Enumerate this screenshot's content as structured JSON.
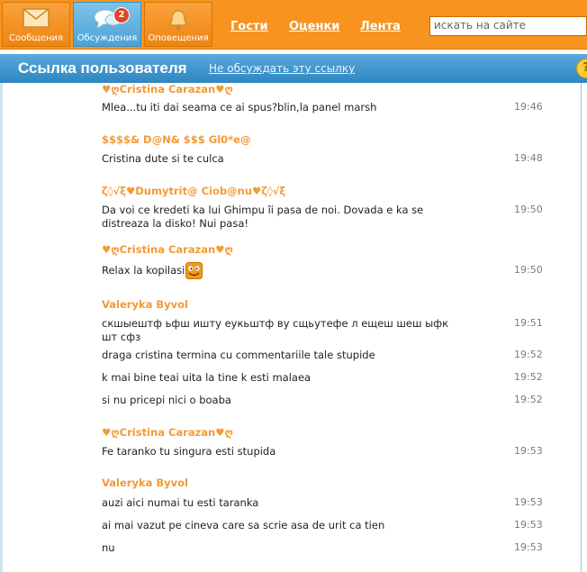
{
  "nav": {
    "tiles": [
      {
        "label": "Сообщения",
        "icon": "envelope-icon"
      },
      {
        "label": "Обсуждения",
        "icon": "chat-bubbles-icon",
        "badge": "2"
      },
      {
        "label": "Оповещения",
        "icon": "bell-icon"
      }
    ],
    "links": [
      "Гости",
      "Оценки",
      "Лента"
    ],
    "search_placeholder": "искать на сайте"
  },
  "header": {
    "title": "Ссылка пользователя",
    "action_link": "Не обсуждать эту ссылку",
    "help_icon": "help-icon"
  },
  "colors": {
    "nav_orange": "#f7931e",
    "header_blue": "#2f86c1",
    "author_orange": "#f39a36",
    "time_gray": "#6f7f88"
  },
  "comments": [
    {
      "author": "♥ღCristina Carazan♥ღ",
      "lines": [
        {
          "text": "Mlea...tu iti dai seama ce ai spus?blin,la panel marsh",
          "time": "19:46"
        }
      ]
    },
    {
      "author": "$$$$& D@N& $$$ Gl0*e@",
      "lines": [
        {
          "text": "Cristina dute si te culca",
          "time": "19:48"
        }
      ]
    },
    {
      "author": "ζ◊√ξ♥Dumytrit@ Ciob@nu♥ζ◊√ξ",
      "lines": [
        {
          "text": "Da voi ce kredeti ka lui Ghimpu îi pasa de noi. Dovada e ka se distreaza la disko! Nui pasa!",
          "time": "19:50"
        }
      ]
    },
    {
      "author": "♥ღCristina Carazan♥ღ",
      "lines": [
        {
          "text": "Relax la kopilasi",
          "time": "19:50",
          "emoticon": "smiley-icon"
        }
      ]
    },
    {
      "author": "Valeryka Byvol",
      "lines": [
        {
          "text": "скшыештф ьфш ишту еукьштф ву сщьутефе л ещеш шеш ыфк шт сфз",
          "time": "19:51"
        },
        {
          "text": "draga cristina termina cu  commentariile tale stupide",
          "time": "19:52"
        },
        {
          "text": " k mai bine teai uita la tine k esti malaea",
          "time": "19:52"
        },
        {
          "text": " si nu pricepi nici o boaba",
          "time": "19:52"
        }
      ]
    },
    {
      "author": "♥ღCristina Carazan♥ღ",
      "lines": [
        {
          "text": "Fe taranko tu singura esti stupida",
          "time": "19:53"
        }
      ]
    },
    {
      "author": "Valeryka Byvol",
      "lines": [
        {
          "text": " auzi aici numai tu esti taranka",
          "time": "19:53"
        },
        {
          "text": " ai mai vazut pe cineva care sa scrie asa de urit ca tien",
          "time": "19:53"
        },
        {
          "text": " nu",
          "time": "19:53"
        }
      ]
    }
  ]
}
